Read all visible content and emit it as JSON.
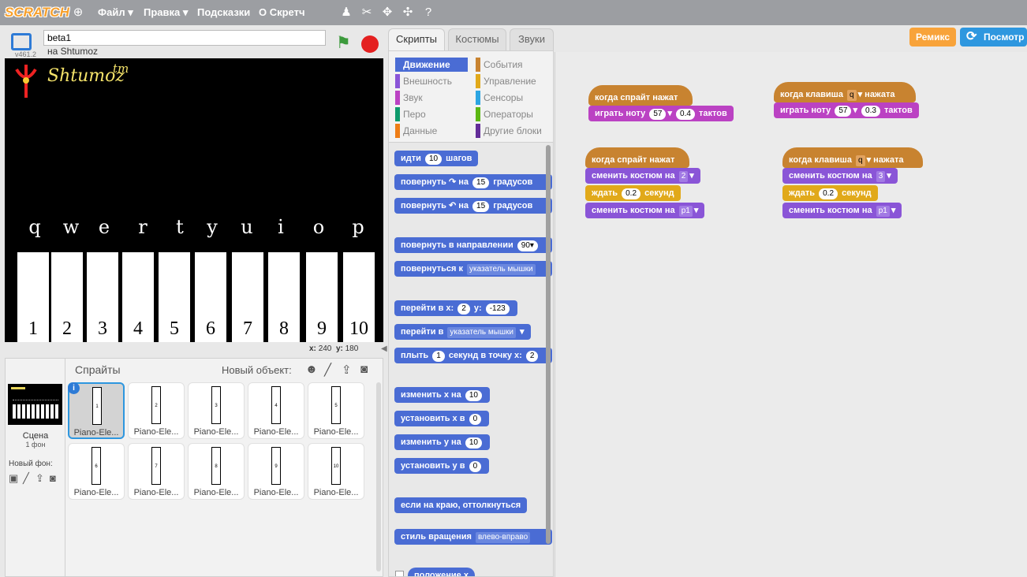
{
  "menubar": {
    "logo": "SCRATCH",
    "items": [
      "Файл",
      "Правка",
      "Подсказки",
      "О Скретч"
    ]
  },
  "stage": {
    "title": "beta1",
    "author": "на Shtumoz",
    "version": "v461.2",
    "brand_text": "Shtumoz",
    "tm": "tm",
    "letters": [
      "q",
      "w",
      "e",
      "r",
      "t",
      "y",
      "u",
      "i",
      "o",
      "p"
    ],
    "keys": [
      "1",
      "2",
      "3",
      "4",
      "5",
      "6",
      "7",
      "8",
      "9",
      "10"
    ],
    "coords": {
      "x_label": "x:",
      "x": "240",
      "y_label": "y:",
      "y": "180"
    }
  },
  "sprites": {
    "header": "Спрайты",
    "new_object": "Новый объект:",
    "scene_label": "Сцена",
    "scene_sub": "1 фон",
    "new_backdrop": "Новый фон:",
    "items": [
      {
        "card": "1",
        "name": "Piano-Ele..."
      },
      {
        "card": "2",
        "name": "Piano-Ele..."
      },
      {
        "card": "3",
        "name": "Piano-Ele..."
      },
      {
        "card": "4",
        "name": "Piano-Ele..."
      },
      {
        "card": "5",
        "name": "Piano-Ele..."
      },
      {
        "card": "6",
        "name": "Piano-Ele..."
      },
      {
        "card": "7",
        "name": "Piano-Ele..."
      },
      {
        "card": "8",
        "name": "Piano-Ele..."
      },
      {
        "card": "9",
        "name": "Piano-Ele..."
      },
      {
        "card": "10",
        "name": "Piano-Ele..."
      }
    ]
  },
  "tabs": [
    "Скрипты",
    "Костюмы",
    "Звуки"
  ],
  "categories": {
    "left": [
      "Движение",
      "Внешность",
      "Звук",
      "Перо",
      "Данные"
    ],
    "right": [
      "События",
      "Управление",
      "Сенсоры",
      "Операторы",
      "Другие блоки"
    ]
  },
  "palette_blocks": {
    "move": {
      "a": "идти",
      "v": "10",
      "b": "шагов"
    },
    "turn_right": {
      "a": "повернуть",
      "icon": "↷",
      "b": "на",
      "v": "15",
      "c": "градусов"
    },
    "turn_left": {
      "a": "повернуть",
      "icon": "↶",
      "b": "на",
      "v": "15",
      "c": "градусов"
    },
    "point_dir": {
      "a": "повернуть в направлении",
      "v": "90▾"
    },
    "point_towards": {
      "a": "повернуться к",
      "v": "указатель мышки"
    },
    "goto_xy": {
      "a": "перейти в x:",
      "x": "2",
      "b": "y:",
      "y": "-123"
    },
    "goto": {
      "a": "перейти в",
      "v": "указатель мышки"
    },
    "glide": {
      "a": "плыть",
      "v": "1",
      "b": "секунд в точку x:",
      "x": "2"
    },
    "change_x": {
      "a": "изменить x на",
      "v": "10"
    },
    "set_x": {
      "a": "установить x в",
      "v": "0"
    },
    "change_y": {
      "a": "изменить y на",
      "v": "10"
    },
    "set_y": {
      "a": "установить y в",
      "v": "0"
    },
    "bounce": {
      "a": "если на краю, оттолкнуться"
    },
    "rotation": {
      "a": "стиль вращения",
      "v": "влево-вправо"
    },
    "xpos": {
      "a": "положение x"
    }
  },
  "buttons": {
    "remix": "Ремикс",
    "see_inside": "Посмотр"
  },
  "scripts": {
    "s1": {
      "hat": "когда спрайт нажат",
      "play_a": "играть ноту",
      "note": "57",
      "beats": "0.4",
      "play_b": "тактов"
    },
    "s2": {
      "hat_a": "когда клавиша",
      "key": "q",
      "hat_b": "нажата",
      "play_a": "играть ноту",
      "note": "57",
      "beats": "0.3",
      "play_b": "тактов"
    },
    "s3": {
      "hat": "когда спрайт нажат",
      "c1": "сменить костюм на",
      "v1": "2",
      "wait_a": "ждать",
      "wait_v": "0.2",
      "wait_b": "секунд",
      "c2": "сменить костюм на",
      "v2": "p1"
    },
    "s4": {
      "hat_a": "когда клавиша",
      "key": "q",
      "hat_b": "нажата",
      "c1": "сменить костюм на",
      "v1": "3",
      "wait_a": "ждать",
      "wait_v": "0.2",
      "wait_b": "секунд",
      "c2": "сменить костюм на",
      "v2": "p1"
    }
  },
  "colors": {
    "motion": "#4a6cd4",
    "looks": "#8a55d7",
    "sound": "#bb42c3",
    "events": "#c88330",
    "control": "#e1a91a",
    "remix": "#f8a33a",
    "see_inside": "#2e97df"
  }
}
